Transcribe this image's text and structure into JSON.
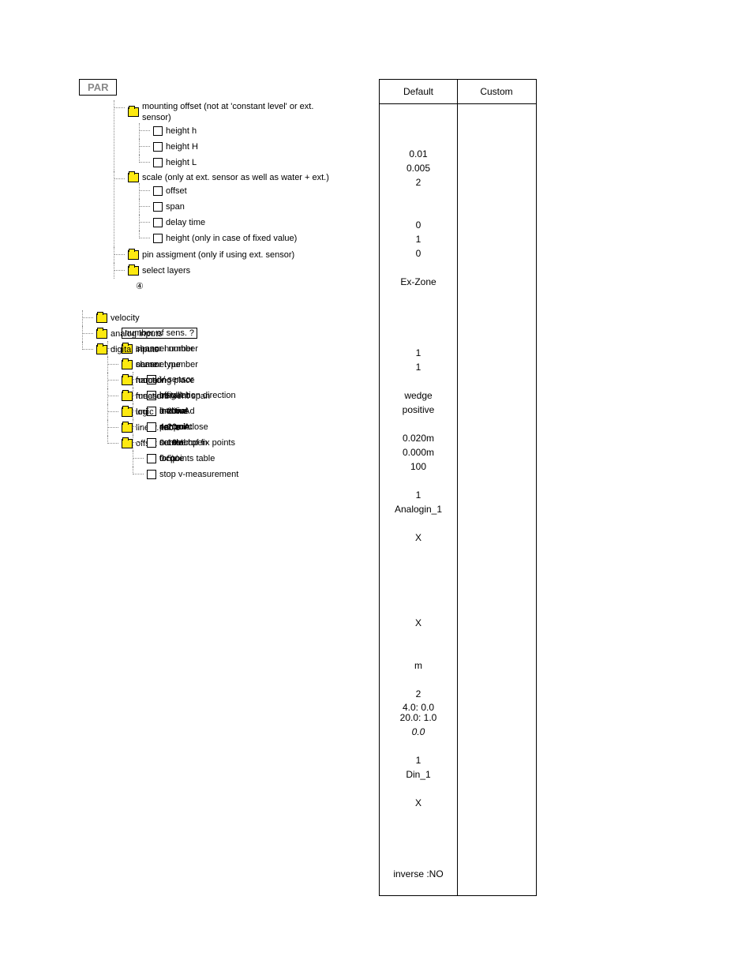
{
  "root_label": "PAR",
  "headers": {
    "default": "Default",
    "custom": "Custom"
  },
  "number_sens_label": "number of sens. ?",
  "circled_four": "④",
  "tree": [
    {
      "id": "mo",
      "label": "mounting offset (not at 'constant level' or ext. sensor)",
      "type": "folder",
      "default": "",
      "children": [
        {
          "id": "mo-h",
          "label": "height h",
          "type": "leaf",
          "default": "0.01"
        },
        {
          "id": "mo-H",
          "label": "height H",
          "type": "leaf",
          "default": "0.005"
        },
        {
          "id": "mo-L",
          "label": "height L",
          "type": "leaf",
          "default": "2"
        }
      ]
    },
    {
      "id": "sc",
      "label": "scale (only at ext. sensor as well as water + ext.)",
      "type": "folder",
      "default": "",
      "children": [
        {
          "id": "sc-off",
          "label": "offset",
          "type": "leaf",
          "default": "0"
        },
        {
          "id": "sc-span",
          "label": "span",
          "type": "leaf",
          "default": "1"
        },
        {
          "id": "sc-dt",
          "label": "delay time",
          "type": "leaf",
          "default": "0"
        },
        {
          "id": "sc-hfv",
          "label": "height (only in case of fixed value)",
          "type": "leaf",
          "default": ""
        }
      ]
    },
    {
      "id": "pin",
      "label": "pin assigment (only if using ext. sensor)",
      "type": "folder",
      "default": "Ex-Zone"
    },
    {
      "id": "sel",
      "label": "select layers",
      "type": "folder",
      "default": ""
    },
    {
      "id": "c4",
      "label": "④",
      "type": "plain",
      "default": ""
    },
    {
      "id": "gap1",
      "label": "",
      "type": "gap",
      "default": ""
    },
    {
      "id": "vel",
      "label": "velocity",
      "type": "folder",
      "default": "",
      "top": true
    },
    {
      "id": "nsens",
      "label": "number of sens. ?",
      "type": "boxed",
      "default": "1",
      "top": true
    },
    {
      "id": "snum",
      "label": "sensor number",
      "type": "folder",
      "default": "1"
    },
    {
      "id": "stype",
      "label": "sensor type",
      "type": "folder",
      "default": "",
      "children": [
        {
          "id": "vsens",
          "label": "V-sensor",
          "type": "leaf",
          "default": "wedge"
        },
        {
          "id": "idir",
          "label": "installation direction",
          "type": "leaf",
          "default": "positive"
        }
      ]
    },
    {
      "id": "mp",
      "label": "mounting place",
      "type": "folder",
      "default": "",
      "children": [
        {
          "id": "mp-h",
          "label": "height h",
          "type": "leaf",
          "default": "0.020m"
        },
        {
          "id": "mp-d",
          "label": "interval d",
          "type": "leaf",
          "default": "0.000m"
        },
        {
          "id": "mp-p",
          "label": "percent",
          "type": "leaf",
          "default": "100"
        }
      ]
    },
    {
      "id": "ai",
      "label": "analog inputs",
      "type": "folder",
      "default": "",
      "top": true,
      "children": [
        {
          "id": "ai-ch",
          "label": "channel number",
          "type": "folder",
          "default": "1"
        },
        {
          "id": "ai-nm",
          "label": "name",
          "type": "folder",
          "default": "Analogin_1"
        },
        {
          "id": "ai-fn",
          "label": "function",
          "type": "folder",
          "default": "",
          "children": [
            {
              "id": "ai-off",
              "label": "off",
              "type": "leaf",
              "default": "X"
            },
            {
              "id": "ai-arc",
              "label": "archive",
              "type": "leaf",
              "default": ""
            },
            {
              "id": "ai-sp",
              "label": "set point",
              "type": "leaf",
              "default": ""
            },
            {
              "id": "ai-sa",
              "label": "set+arch",
              "type": "leaf",
              "default": ""
            }
          ]
        },
        {
          "id": "ai-ms",
          "label": "measurement span",
          "type": "folder",
          "default": "",
          "children": [
            {
              "id": "ms-020",
              "label": "0-20mA",
              "type": "leaf",
              "default": ""
            },
            {
              "id": "ms-420",
              "label": "4-20mA",
              "type": "leaf",
              "default": "X"
            },
            {
              "id": "ms-010v",
              "label": "0-10V",
              "type": "leaf",
              "default": ""
            },
            {
              "id": "ms-05v",
              "label": "0-5V",
              "type": "leaf",
              "default": ""
            }
          ]
        },
        {
          "id": "ai-un",
          "label": "units",
          "type": "folder",
          "default": "m"
        },
        {
          "id": "ai-lt",
          "label": "linear. table",
          "type": "folder",
          "default": "",
          "children": [
            {
              "id": "lt-nf",
              "label": "number of fix points",
              "type": "leaf",
              "default": "2"
            },
            {
              "id": "lt-ft",
              "label": "fix points table",
              "type": "leaf",
              "default": "4.0: 0.0\n20.0: 1.0"
            }
          ]
        },
        {
          "id": "ai-of",
          "label": "offset",
          "type": "folder",
          "default": "0.0",
          "italic": true
        }
      ]
    },
    {
      "id": "di",
      "label": "digital inputs",
      "type": "folder",
      "default": "",
      "top": true,
      "children": [
        {
          "id": "di-ch",
          "label": "channel number",
          "type": "folder",
          "default": "1"
        },
        {
          "id": "di-nm",
          "label": "name",
          "type": "folder",
          "default": "Din_1"
        },
        {
          "id": "di-fn",
          "label": "function",
          "type": "folder",
          "default": "",
          "children": [
            {
              "id": "di-in",
              "label": "inactive",
              "type": "leaf",
              "default": "X"
            },
            {
              "id": "di-cc",
              "label": "control close",
              "type": "leaf",
              "default": ""
            },
            {
              "id": "di-co",
              "label": "control open",
              "type": "leaf",
              "default": ""
            },
            {
              "id": "di-tq",
              "label": "torque",
              "type": "leaf",
              "default": ""
            },
            {
              "id": "di-sv",
              "label": "stop v-measurement",
              "type": "leaf",
              "default": ""
            }
          ]
        },
        {
          "id": "di-lg",
          "label": "logic",
          "type": "folder",
          "default": "inverse :NO"
        }
      ]
    }
  ]
}
